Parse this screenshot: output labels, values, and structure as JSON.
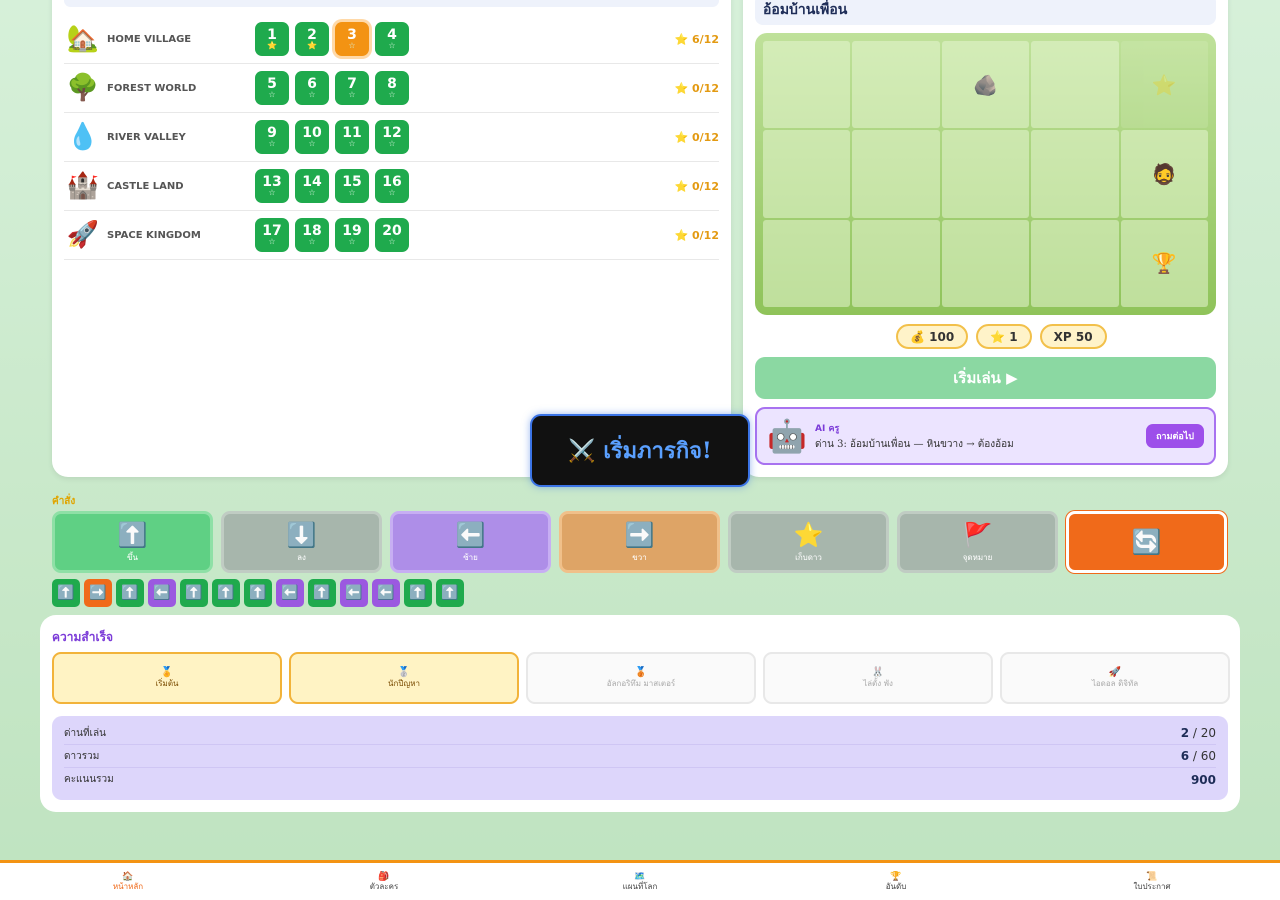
{
  "worlds": [
    {
      "icon": "🏡",
      "name": "HOME VILLAGE",
      "stars": "⭐ 6/12",
      "levels": [
        {
          "num": "1",
          "star": "⭐",
          "on": true,
          "current": false
        },
        {
          "num": "2",
          "star": "⭐",
          "on": true,
          "current": false
        },
        {
          "num": "3",
          "star": "☆",
          "on": false,
          "current": true
        },
        {
          "num": "4",
          "star": "☆",
          "on": false,
          "current": false
        }
      ]
    },
    {
      "icon": "🌳",
      "name": "FOREST WORLD",
      "stars": "⭐ 0/12",
      "levels": [
        {
          "num": "5",
          "star": "☆"
        },
        {
          "num": "6",
          "star": "☆"
        },
        {
          "num": "7",
          "star": "☆"
        },
        {
          "num": "8",
          "star": "☆"
        }
      ]
    },
    {
      "icon": "💧",
      "name": "RIVER VALLEY",
      "stars": "⭐ 0/12",
      "levels": [
        {
          "num": "9",
          "star": "☆"
        },
        {
          "num": "10",
          "star": "☆"
        },
        {
          "num": "11",
          "star": "☆"
        },
        {
          "num": "12",
          "star": "☆"
        }
      ]
    },
    {
      "icon": "🏰",
      "name": "CASTLE LAND",
      "stars": "⭐ 0/12",
      "levels": [
        {
          "num": "13",
          "star": "☆"
        },
        {
          "num": "14",
          "star": "☆"
        },
        {
          "num": "15",
          "star": "☆"
        },
        {
          "num": "16",
          "star": "☆"
        }
      ]
    },
    {
      "icon": "🚀",
      "name": "SPACE KINGDOM",
      "stars": "⭐ 0/12",
      "levels": [
        {
          "num": "17",
          "star": "☆"
        },
        {
          "num": "18",
          "star": "☆"
        },
        {
          "num": "19",
          "star": "☆"
        },
        {
          "num": "20",
          "star": "☆"
        }
      ]
    }
  ],
  "map": {
    "title": "อ้อมบ้านเพื่อน",
    "cells": [
      "",
      "",
      "🪨",
      "",
      "⭐",
      "",
      "",
      "",
      "",
      "🧔",
      "",
      "",
      "",
      "",
      "🏆"
    ],
    "faint_cells": [
      4
    ]
  },
  "rewards": {
    "coins": "💰 100",
    "stars": "⭐ 1",
    "xp": "XP 50"
  },
  "play_label": "เริ่มเล่น ▶",
  "ai": {
    "robot": "🤖",
    "name": "AI ครู",
    "message": "ด่าน 3: อ้อมบ้านเพื่อน — หินขวาง → ต้องอ้อม",
    "ask_label": "ถามต่อไป"
  },
  "toast": "⚔️ เริ่มภารกิจ!",
  "commands_label": "คำสั่ง",
  "commands": [
    {
      "cls": "up",
      "icon": "⬆️",
      "label": "ขึ้น"
    },
    {
      "cls": "down",
      "icon": "⬇️",
      "label": "ลง"
    },
    {
      "cls": "left",
      "icon": "⬅️",
      "label": "ซ้าย"
    },
    {
      "cls": "right",
      "icon": "➡️",
      "label": "ขวา"
    },
    {
      "cls": "star",
      "icon": "⭐",
      "label": "เก็บดาว"
    },
    {
      "cls": "flag",
      "icon": "🚩",
      "label": "จุดหมาย"
    },
    {
      "cls": "reset",
      "icon": "🔄",
      "label": ""
    }
  ],
  "sequence": [
    {
      "c": "g",
      "i": "⬆️"
    },
    {
      "c": "o",
      "i": "➡️"
    },
    {
      "c": "g",
      "i": "⬆️"
    },
    {
      "c": "p",
      "i": "⬅️"
    },
    {
      "c": "g",
      "i": "⬆️"
    },
    {
      "c": "g",
      "i": "⬆️"
    },
    {
      "c": "g",
      "i": "⬆️"
    },
    {
      "c": "p",
      "i": "⬅️"
    },
    {
      "c": "g",
      "i": "⬆️"
    },
    {
      "c": "p",
      "i": "⬅️"
    },
    {
      "c": "p",
      "i": "⬅️"
    },
    {
      "c": "g",
      "i": "⬆️"
    },
    {
      "c": "g",
      "i": "⬆️"
    }
  ],
  "achievements_title": "ความสำเร็จ",
  "achievements": [
    {
      "icon": "🏅",
      "label": "เริ่มต้น",
      "on": true
    },
    {
      "icon": "🥈",
      "label": "นักปีญหา",
      "on": true
    },
    {
      "icon": "🥉",
      "label": "อัลกอริทึม มาสเตอร์",
      "on": false
    },
    {
      "icon": "🐰",
      "label": "ไล่ตั้ง พัง",
      "on": false
    },
    {
      "icon": "🚀",
      "label": "ไอดอล ดิจิทัล",
      "on": false
    }
  ],
  "stats": [
    {
      "label": "ด่านที่เล่น",
      "value": "2",
      "total": " / 20"
    },
    {
      "label": "ดาวรวม",
      "value": "6",
      "total": " / 60"
    },
    {
      "label": "คะแนนรวม",
      "value": "900",
      "total": ""
    }
  ],
  "nav": [
    {
      "icon": "🏠",
      "label": "หน้าหลัก",
      "active": true
    },
    {
      "icon": "🎒",
      "label": "ตัวละคร",
      "active": false
    },
    {
      "icon": "🗺️",
      "label": "แผนที่โลก",
      "active": false
    },
    {
      "icon": "🏆",
      "label": "อันดับ",
      "active": false
    },
    {
      "icon": "📜",
      "label": "ใบประกาศ",
      "active": false
    }
  ]
}
